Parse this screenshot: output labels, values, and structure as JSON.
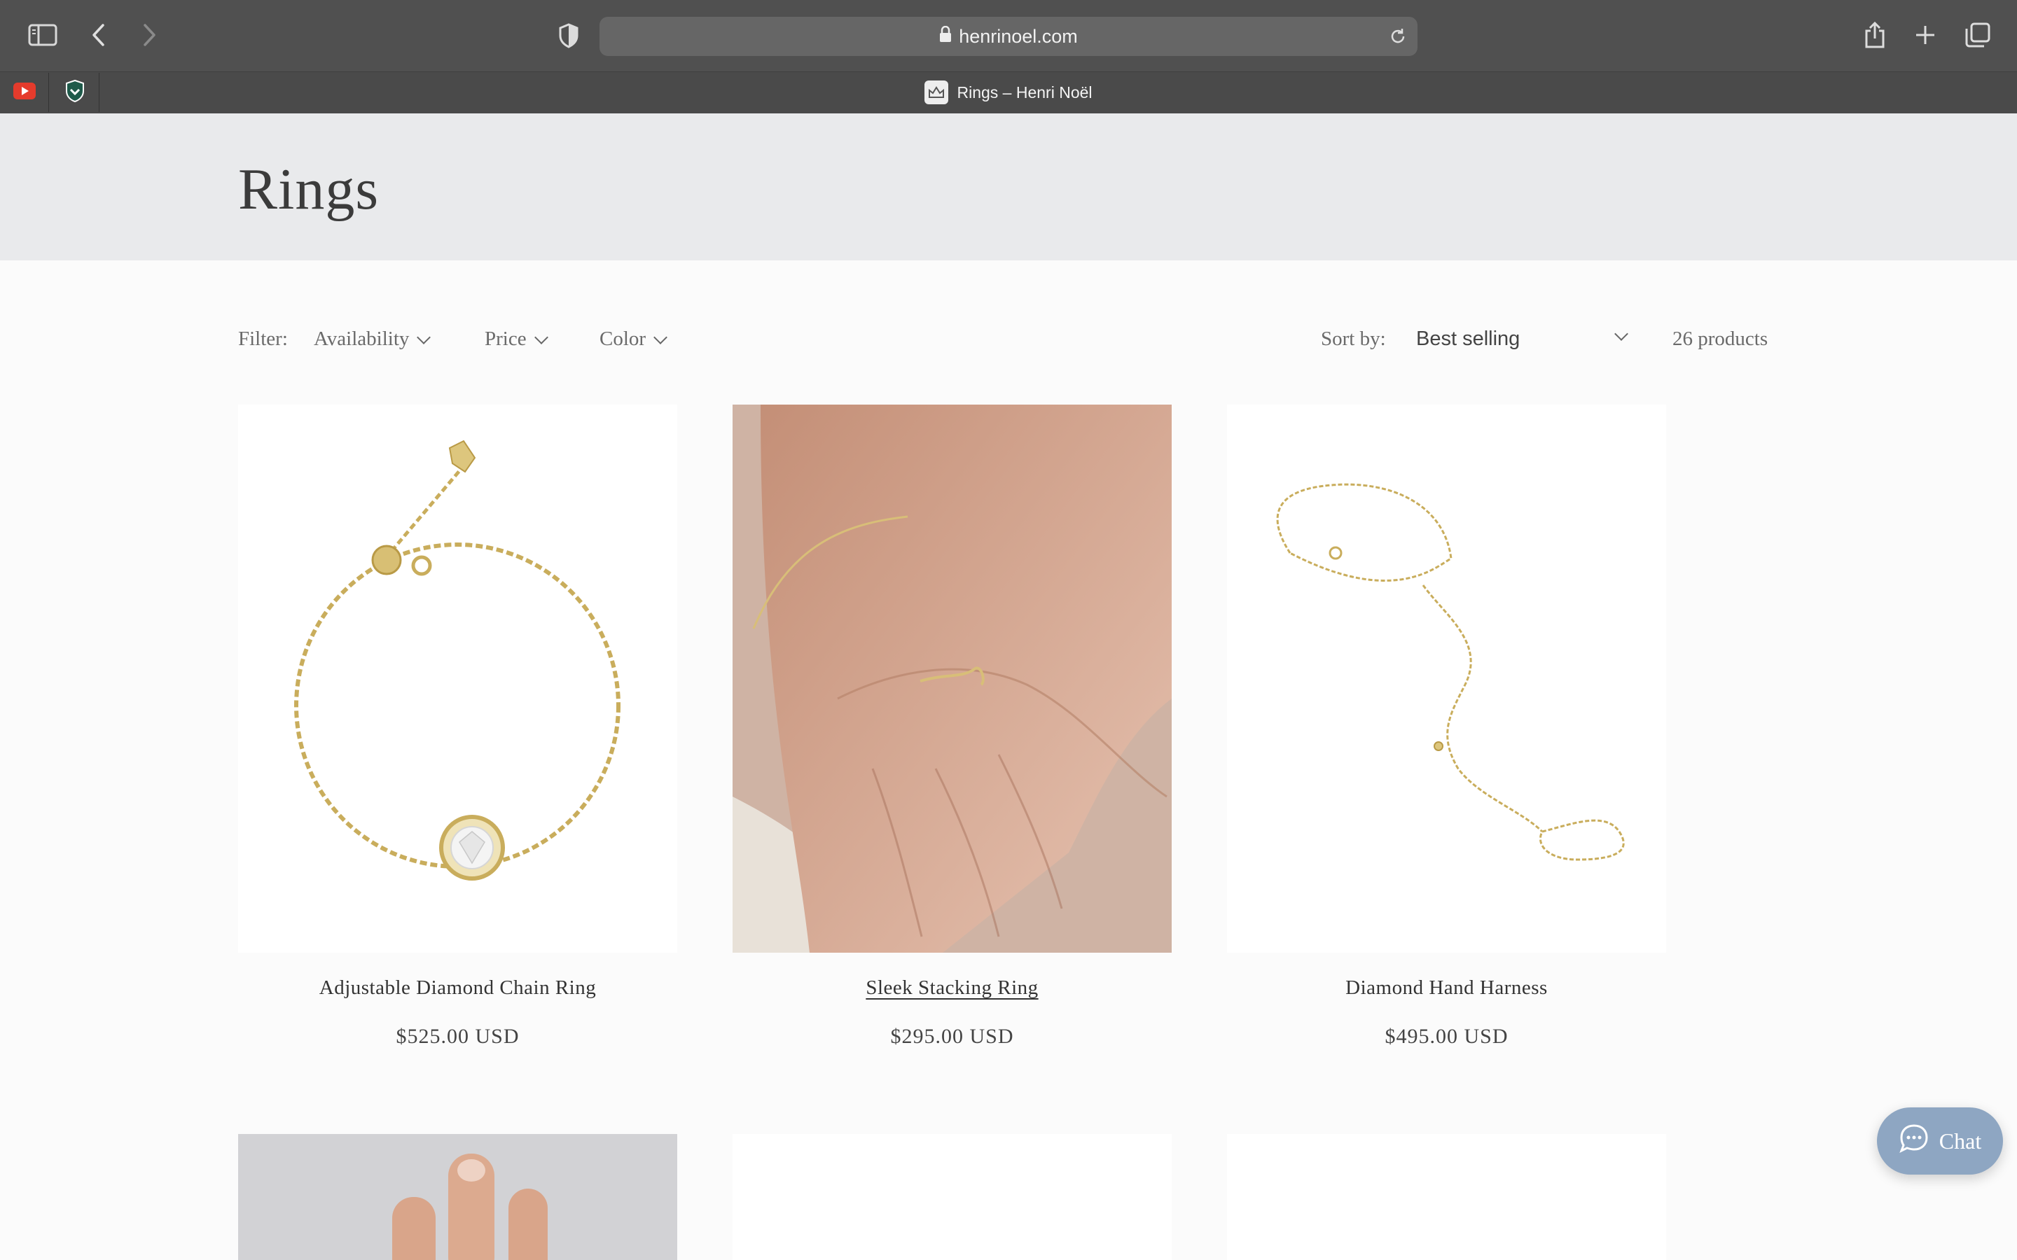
{
  "browser": {
    "url": "henrinoel.com",
    "tab_title": "Rings – Henri Noël",
    "pinned_tabs": [
      "youtube-icon",
      "shield-badge-icon"
    ]
  },
  "page": {
    "title": "Rings",
    "filter_label": "Filter:",
    "filters": [
      "Availability",
      "Price",
      "Color"
    ],
    "sort_label": "Sort by:",
    "sort_value": "Best selling",
    "product_count": "26 products"
  },
  "products": [
    {
      "name": "Adjustable Diamond Chain Ring",
      "price": "$525.00 USD"
    },
    {
      "name": "Sleek Stacking Ring",
      "price": "$295.00 USD"
    },
    {
      "name": "Diamond Hand Harness",
      "price": "$495.00 USD"
    }
  ],
  "chat": {
    "label": "Chat"
  },
  "colors": {
    "hero_bg": "#e9eaec",
    "chat_bg": "#8ea6c2",
    "gold": "#c9ad5c",
    "toolbar": "#505050"
  }
}
